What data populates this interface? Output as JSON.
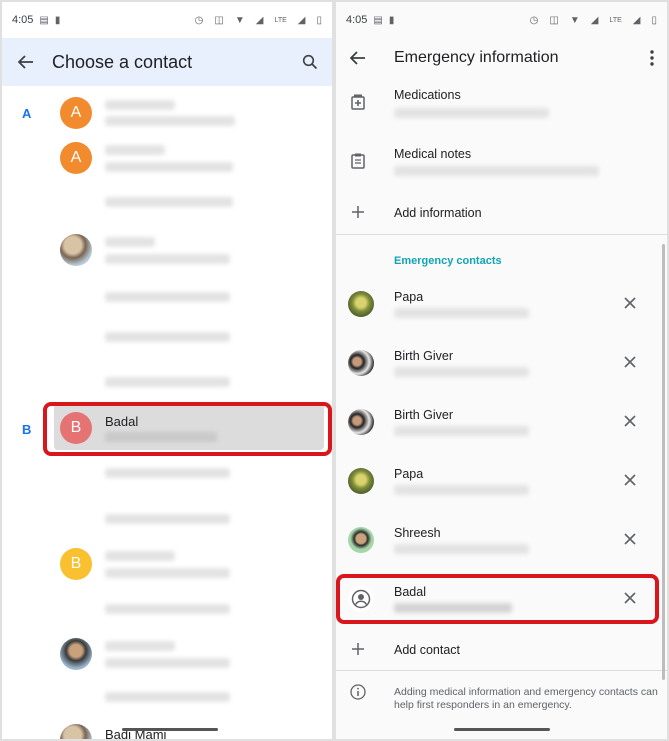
{
  "status_bar": {
    "left_time": "4:05",
    "right_time": "4:05",
    "network": "LTE"
  },
  "contact_picker": {
    "title": "Choose a contact",
    "sections": [
      {
        "letter": "A"
      },
      {
        "letter": "B"
      }
    ],
    "avatar_letters": {
      "a1": "A",
      "a2": "A",
      "badal": "B",
      "b2": "B"
    },
    "selected_contact": "Badal",
    "bottom_partial_contact": "Badi Mami",
    "icons": {
      "back": "back-arrow-icon",
      "search": "search-icon"
    }
  },
  "emergency_info": {
    "title": "Emergency information",
    "medical_items": [
      {
        "title": "Medications",
        "icon": "medication-icon"
      },
      {
        "title": "Medical notes",
        "icon": "clipboard-icon"
      }
    ],
    "add_information_label": "Add information",
    "emergency_contacts_header": "Emergency contacts",
    "contacts": [
      {
        "name": "Papa",
        "avatar": "plant"
      },
      {
        "name": "Birth Giver",
        "avatar": "couple"
      },
      {
        "name": "Birth Giver",
        "avatar": "couple"
      },
      {
        "name": "Papa",
        "avatar": "plant"
      },
      {
        "name": "Shreesh",
        "avatar": "green"
      },
      {
        "name": "Badal",
        "avatar": "generic"
      }
    ],
    "add_contact_label": "Add contact",
    "footer_note": "Adding medical information and emergency contacts can help first responders in an emergency.",
    "icons": {
      "back": "back-arrow-icon",
      "more": "more-vert-icon",
      "remove": "close-icon",
      "info": "info-icon",
      "add": "plus-icon"
    }
  },
  "colors": {
    "accent_blue": "#1a73e8",
    "section_teal": "#12a4b6",
    "highlight_red": "#d9161b",
    "header_bg": "#e8f0fe"
  }
}
